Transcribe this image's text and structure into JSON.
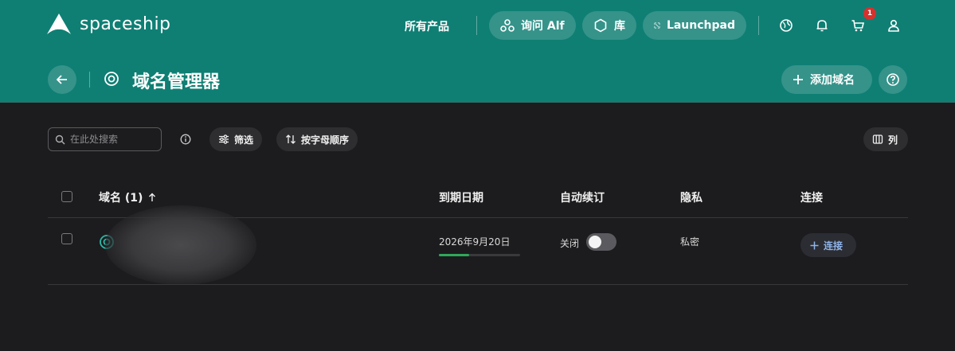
{
  "brand": {
    "name": "spaceship"
  },
  "nav": {
    "all_products": "所有产品",
    "ask_alf": "询问 Alf",
    "library": "库",
    "launchpad": "Launchpad",
    "cart_count": "1"
  },
  "page": {
    "title": "域名管理器",
    "add_domain": "添加域名"
  },
  "toolbar": {
    "search_placeholder": "在此处搜索",
    "filter": "筛选",
    "sort": "按字母顺序",
    "columns": "列"
  },
  "table": {
    "headers": {
      "domain": "域名 (1)",
      "expiry": "到期日期",
      "auto_renew": "自动续订",
      "privacy": "隐私",
      "connect": "连接"
    },
    "rows": [
      {
        "expiry": "2026年9月20日",
        "expiry_progress": 0.37,
        "auto_renew_label": "关闭",
        "auto_renew_on": false,
        "privacy": "私密",
        "connect_label": "连接"
      }
    ]
  },
  "colors": {
    "header_bg": "#0f7f74",
    "page_bg": "#1c1c1e",
    "progress": "#2fa85a",
    "badge": "#d6312d",
    "link": "#8fb3e8"
  }
}
